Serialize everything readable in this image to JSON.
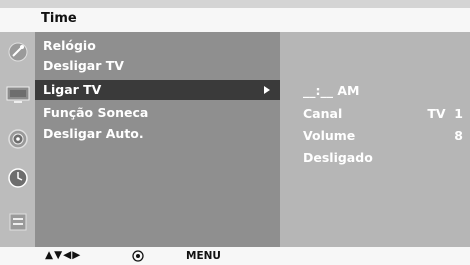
{
  "title": "Time",
  "icons": [
    "satellite-dish-icon",
    "tv-picture-icon",
    "speaker-icon",
    "clock-icon",
    "option-box-icon"
  ],
  "menu": {
    "items": [
      {
        "label": "Relógio",
        "selected": false
      },
      {
        "label": "Desligar TV",
        "selected": false
      },
      {
        "label": "Ligar TV",
        "selected": true
      },
      {
        "label": "Função Soneca",
        "selected": false
      },
      {
        "label": "Desligar Auto.",
        "selected": false
      }
    ]
  },
  "submenu": {
    "time": "__:__ AM",
    "canal_label": "Canal",
    "canal_value": "TV  1",
    "volume_label": "Volume",
    "volume_value": "8",
    "status": "Desligado"
  },
  "bottom": {
    "nav": "▲▼◀▶",
    "ok": "ok-icon",
    "menu": "MENU"
  }
}
